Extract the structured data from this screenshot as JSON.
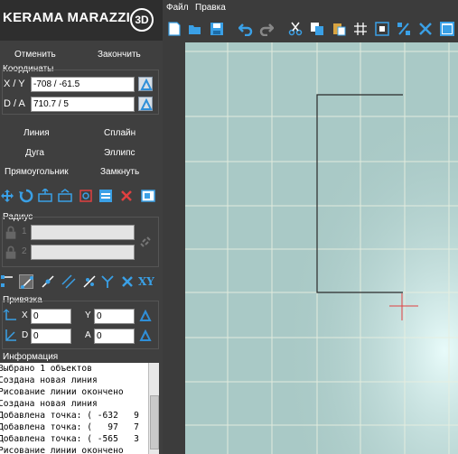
{
  "brand": {
    "name": "KERAMA MARAZZI",
    "badge": "3D"
  },
  "menu": {
    "file": "Файл",
    "edit": "Правка"
  },
  "actions": {
    "undo": "Отменить",
    "finish": "Закончить"
  },
  "coords": {
    "title": "Координаты",
    "xy_label": "X / Y",
    "xy_value": "-708 / -61.5",
    "da_label": "D / A",
    "da_value": "710.7 / 5"
  },
  "draw_tools": {
    "line": "Линия",
    "spline": "Сплайн",
    "arc": "Дуга",
    "ellipse": "Эллипс",
    "rectangle": "Прямоугольник",
    "close": "Замкнуть"
  },
  "radius": {
    "title": "Радиус",
    "row1_num": "1",
    "row2_num": "2",
    "row1_value": "",
    "row2_value": ""
  },
  "snap": {
    "title": "Привязка",
    "x_label": "X",
    "x_value": "0",
    "y_label": "Y",
    "y_value": "0",
    "d_label": "D",
    "d_value": "0",
    "a_label": "A",
    "a_value": "0",
    "xy_tool": "XY"
  },
  "info": {
    "title": "Информация",
    "lines": [
      "Выбрано 1 объектов",
      "Создана новая линия",
      "Рисование линии окончено",
      "Создана новая линия",
      "Добавлена точка: ( -632   9",
      "Добавлена точка: (   97   7",
      "Добавлена точка: ( -565   3",
      "Рисование линии окончено"
    ]
  },
  "colors": {
    "panel_bg": "#3f3f3f",
    "canvas_bg": "#a9c9c6",
    "grid_line": "#e8efe0",
    "accent_blue": "#2f8fd8",
    "cursor_red": "#e04040"
  }
}
